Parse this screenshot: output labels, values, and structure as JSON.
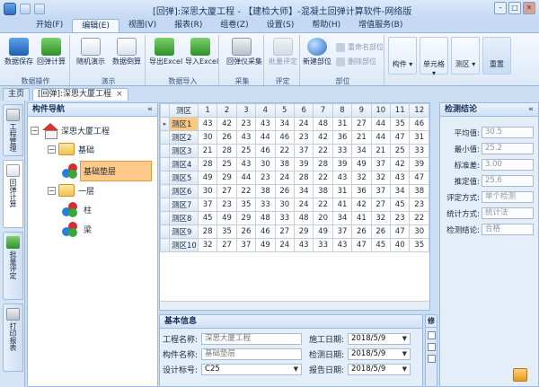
{
  "window": {
    "title": "[回弹]:深思大厦工程 - 【建检大师】-混凝土回弹计算软件-网络版"
  },
  "menu": [
    "开始(F)",
    "编辑(E)",
    "视图(V)",
    "报表(R)",
    "组卷(Z)",
    "设置(S)",
    "帮助(H)",
    "增值服务(B)"
  ],
  "menu_active": 1,
  "ribbon": {
    "groups": [
      "数据操作",
      "演示",
      "数据导入",
      "采集",
      "评定",
      "部位"
    ],
    "save": "数据保存",
    "calc": "回弹计算",
    "demo": "随机演示",
    "dump": "数据倒算",
    "export_excel": "导出Excel",
    "import_excel": "导入Excel",
    "collect": "回弹仪采集",
    "batch": "批量评定",
    "new_part": "新建部位",
    "rename": "重命名部位",
    "delete": "删除部位",
    "component": "构件",
    "cell": "单元格",
    "zone": "测区",
    "reset": "重置"
  },
  "tabs": {
    "home": "主页",
    "doc": "[回弹]:深思大厦工程"
  },
  "side_tabs": [
    "工程管理",
    "回弹计算",
    "批量评定",
    "打印报表"
  ],
  "tree": {
    "title": "构件导航",
    "collapse": "«",
    "nodes": {
      "root": "深思大厦工程",
      "n1": "基础",
      "n2": "基础垫层",
      "n3": "一层",
      "n4": "柱",
      "n5": "梁"
    }
  },
  "grid": {
    "header_first": "测区",
    "cols": [
      "1",
      "2",
      "3",
      "4",
      "5",
      "6",
      "7",
      "8",
      "9",
      "10",
      "11",
      "12"
    ],
    "rows": [
      {
        "name": "测区1",
        "values": [
          43,
          42,
          23,
          43,
          34,
          24,
          48,
          31,
          27,
          44,
          35,
          46
        ]
      },
      {
        "name": "测区2",
        "values": [
          30,
          26,
          43,
          44,
          46,
          23,
          42,
          36,
          21,
          44,
          47,
          31
        ]
      },
      {
        "name": "测区3",
        "values": [
          21,
          28,
          25,
          46,
          22,
          37,
          22,
          33,
          34,
          21,
          25,
          33
        ]
      },
      {
        "name": "测区4",
        "values": [
          28,
          25,
          43,
          30,
          38,
          39,
          28,
          39,
          49,
          37,
          42,
          39
        ]
      },
      {
        "name": "测区5",
        "values": [
          49,
          29,
          44,
          23,
          24,
          28,
          22,
          43,
          32,
          32,
          43,
          47
        ]
      },
      {
        "name": "测区6",
        "values": [
          30,
          27,
          22,
          38,
          26,
          34,
          38,
          31,
          36,
          37,
          34,
          38
        ]
      },
      {
        "name": "测区7",
        "values": [
          37,
          23,
          35,
          33,
          30,
          24,
          22,
          41,
          42,
          27,
          45,
          23
        ]
      },
      {
        "name": "测区8",
        "values": [
          45,
          49,
          29,
          48,
          33,
          48,
          20,
          34,
          41,
          32,
          23,
          22
        ]
      },
      {
        "name": "测区9",
        "values": [
          28,
          35,
          26,
          46,
          27,
          29,
          49,
          37,
          26,
          26,
          47,
          30
        ]
      },
      {
        "name": "测区10",
        "values": [
          32,
          27,
          37,
          49,
          24,
          43,
          33,
          43,
          47,
          45,
          40,
          35
        ]
      }
    ]
  },
  "basic": {
    "title": "基本信息",
    "project_label": "工程名称:",
    "project": "深思大厦工程",
    "component_label": "构件名称:",
    "component": "基础垫层",
    "grade_label": "设计标号:",
    "grade": "C25",
    "build_label": "施工日期:",
    "build": "2018/5/9",
    "test_label": "检测日期:",
    "test": "2018/5/9",
    "report_label": "报告日期:",
    "report": "2018/5/9"
  },
  "minipanel": {
    "title": "修"
  },
  "result": {
    "title": "检测结论",
    "avg_label": "平均值:",
    "avg": "30.5",
    "min_label": "最小值:",
    "min": "25.2",
    "std_label": "标准差:",
    "std": "3.00",
    "est_label": "推定值:",
    "est": "25.6",
    "method_label": "评定方式:",
    "method": "单个检测",
    "stat_label": "统计方式:",
    "stat": "统计法",
    "conclusion_label": "检测结论:",
    "conclusion": "合格"
  }
}
